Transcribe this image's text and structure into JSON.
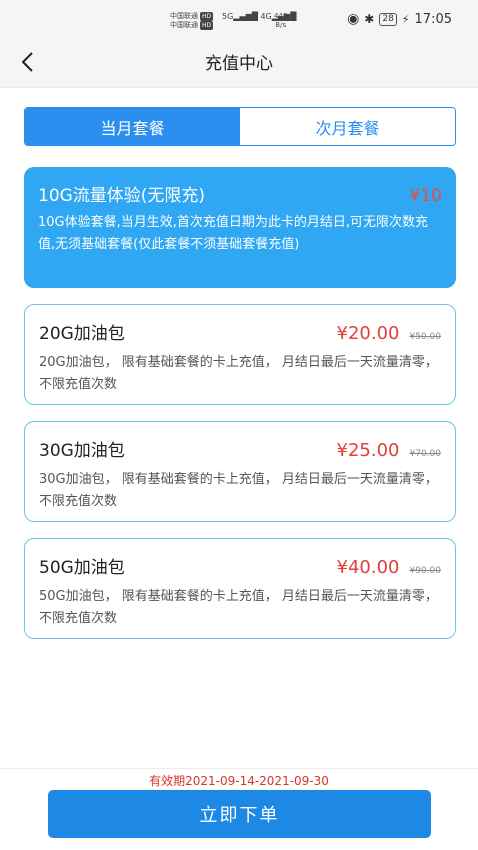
{
  "status_bar": {
    "carrier1": "中国联通",
    "carrier2": "中国联通",
    "hd": "HD",
    "signal1": "5G",
    "signal2": "4G",
    "net_speed": "446",
    "net_unit": "B/s",
    "battery": "28",
    "time": "17:05"
  },
  "header": {
    "title": "充值中心"
  },
  "tabs": [
    {
      "label": "当月套餐",
      "active": true
    },
    {
      "label": "次月套餐",
      "active": false
    }
  ],
  "packages": [
    {
      "name": "10G流量体验(无限充)",
      "price": "¥10",
      "original_price": "",
      "description": "10G体验套餐,当月生效,首次充值日期为此卡的月结日,可无限次数充值,无须基础套餐(仅此套餐不须基础套餐充值)",
      "selected": true
    },
    {
      "name": "20G加油包",
      "price": "¥20.00",
      "original_price": "¥50.00",
      "description": "20G加油包， 限有基础套餐的卡上充值， 月结日最后一天流量清零， 不限充值次数",
      "selected": false
    },
    {
      "name": "30G加油包",
      "price": "¥25.00",
      "original_price": "¥70.00",
      "description": "30G加油包， 限有基础套餐的卡上充值， 月结日最后一天流量清零， 不限充值次数",
      "selected": false
    },
    {
      "name": "50G加油包",
      "price": "¥40.00",
      "original_price": "¥90.00",
      "description": "50G加油包， 限有基础套餐的卡上充值， 月结日最后一天流量清零， 不限充值次数",
      "selected": false
    }
  ],
  "footer": {
    "validity": "有效期2021-09-14-2021-09-30",
    "order_button": "立即下单"
  },
  "colors": {
    "accent": "#2b8fef",
    "selected_card": "#2fa7f2",
    "price_red": "#e0403a",
    "card_border": "#6cc3ec",
    "button": "#1e88e5"
  }
}
